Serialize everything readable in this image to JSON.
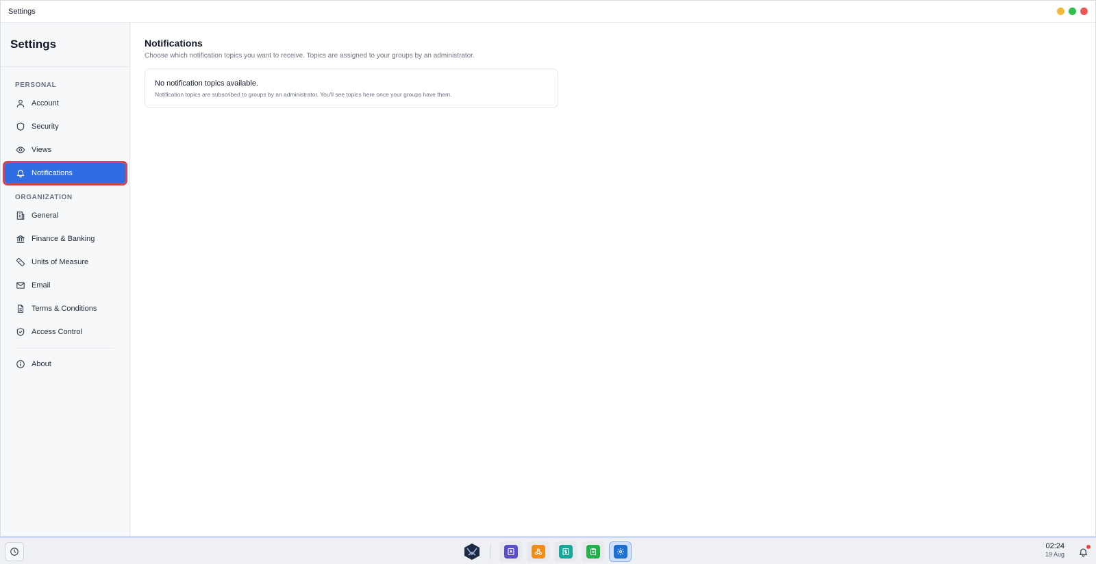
{
  "window": {
    "title": "Settings",
    "controls": {
      "minimize_color": "#f4b93a",
      "maximize_color": "#2fbf4d",
      "close_color": "#ef5757"
    }
  },
  "sidebar": {
    "title": "Settings",
    "sections": {
      "personal": "PERSONAL",
      "organization": "ORGANIZATION"
    },
    "personal_items": [
      {
        "label": "Account",
        "icon": "user-icon"
      },
      {
        "label": "Security",
        "icon": "shield-icon"
      },
      {
        "label": "Views",
        "icon": "eye-icon"
      },
      {
        "label": "Notifications",
        "icon": "bell-icon",
        "active": true
      }
    ],
    "organization_items": [
      {
        "label": "General",
        "icon": "building-icon"
      },
      {
        "label": "Finance & Banking",
        "icon": "bank-icon"
      },
      {
        "label": "Units of Measure",
        "icon": "ruler-icon"
      },
      {
        "label": "Email",
        "icon": "mail-icon"
      },
      {
        "label": "Terms & Conditions",
        "icon": "document-icon"
      },
      {
        "label": "Access Control",
        "icon": "shield-check-icon"
      }
    ],
    "about": {
      "label": "About",
      "icon": "info-icon"
    },
    "accent_color": "#2f6be3",
    "highlight_color": "#d9454f"
  },
  "main": {
    "title": "Notifications",
    "subtitle": "Choose which notification topics you want to receive. Topics are assigned to your groups by an administrator.",
    "empty_card": {
      "title": "No notification topics available.",
      "description": "Notification topics are subscribed to groups by an administrator. You'll see topics here once your groups have them."
    }
  },
  "taskbar": {
    "apps": [
      {
        "name": "launcher-logo-icon"
      },
      {
        "name": "contacts-app-icon",
        "color": "#5b4fc7"
      },
      {
        "name": "network-app-icon",
        "color": "#f08c1a"
      },
      {
        "name": "finance-app-icon",
        "color": "#15a89b"
      },
      {
        "name": "clipboard-app-icon",
        "color": "#22b04a"
      },
      {
        "name": "settings-app-icon",
        "color": "#1f6fd1",
        "active": true
      }
    ],
    "clock": {
      "time": "02:24",
      "date": "19 Aug"
    }
  }
}
